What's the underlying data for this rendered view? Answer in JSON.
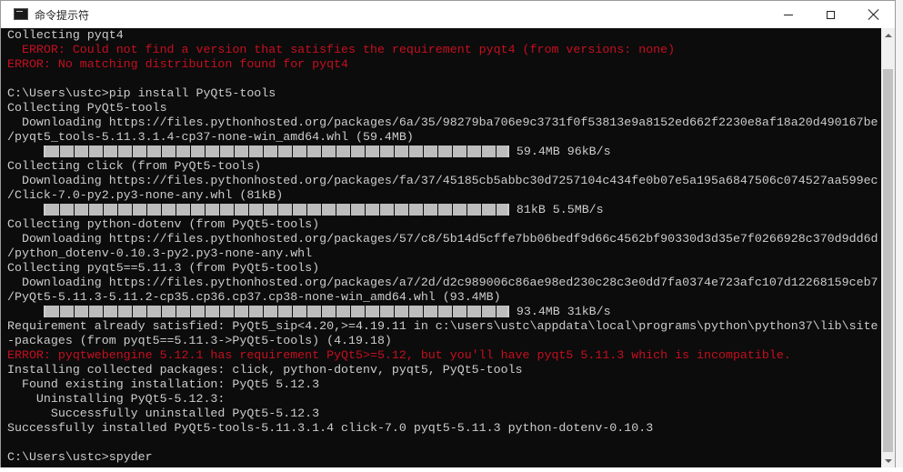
{
  "window": {
    "title": "命令提示符",
    "icon": "console-icon",
    "controls": {
      "minimize": "minimize-icon",
      "maximize": "maximize-icon",
      "close": "close-icon"
    }
  },
  "colors": {
    "console_bg": "#0c0c0c",
    "console_text": "#cccccc",
    "error_text": "#c50f1f"
  },
  "console": {
    "lines": [
      {
        "text": "Collecting pyqt4",
        "type": "normal"
      },
      {
        "text": "  ERROR: Could not find a version that satisfies the requirement pyqt4 (from versions: none)",
        "type": "error"
      },
      {
        "text": "ERROR: No matching distribution found for pyqt4",
        "type": "error"
      },
      {
        "text": "",
        "type": "normal"
      },
      {
        "text": "C:\\Users\\ustc>pip install PyQt5-tools",
        "type": "normal"
      },
      {
        "text": "Collecting PyQt5-tools",
        "type": "normal"
      },
      {
        "text": "  Downloading https://files.pythonhosted.org/packages/6a/35/98279ba706e9c3731f0f53813e9a8152ed662f2230e8af18a20d490167be",
        "type": "normal"
      },
      {
        "text": "/pyqt5_tools-5.11.3.1.4-cp37-none-win_amd64.whl (59.4MB)",
        "type": "normal"
      },
      {
        "type": "progress",
        "progress": 1.0,
        "text": " 59.4MB 96kB/s"
      },
      {
        "text": "Collecting click (from PyQt5-tools)",
        "type": "normal"
      },
      {
        "text": "  Downloading https://files.pythonhosted.org/packages/fa/37/45185cb5abbc30d7257104c434fe0b07e5a195a6847506c074527aa599ec",
        "type": "normal"
      },
      {
        "text": "/Click-7.0-py2.py3-none-any.whl (81kB)",
        "type": "normal"
      },
      {
        "type": "progress",
        "progress": 1.0,
        "text": " 81kB 5.5MB/s"
      },
      {
        "text": "Collecting python-dotenv (from PyQt5-tools)",
        "type": "normal"
      },
      {
        "text": "  Downloading https://files.pythonhosted.org/packages/57/c8/5b14d5cffe7bb06bedf9d66c4562bf90330d3d35e7f0266928c370d9dd6d",
        "type": "normal"
      },
      {
        "text": "/python_dotenv-0.10.3-py2.py3-none-any.whl",
        "type": "normal"
      },
      {
        "text": "Collecting pyqt5==5.11.3 (from PyQt5-tools)",
        "type": "normal"
      },
      {
        "text": "  Downloading https://files.pythonhosted.org/packages/a7/2d/d2c989006c86ae98ed230c28c3e0dd7fa0374e723afc107d12268159ceb7",
        "type": "normal"
      },
      {
        "text": "/PyQt5-5.11.3-5.11.2-cp35.cp36.cp37.cp38-none-win_amd64.whl (93.4MB)",
        "type": "normal"
      },
      {
        "type": "progress",
        "progress": 1.0,
        "text": " 93.4MB 31kB/s"
      },
      {
        "text": "Requirement already satisfied: PyQt5_sip<4.20,>=4.19.11 in c:\\users\\ustc\\appdata\\local\\programs\\python\\python37\\lib\\site",
        "type": "normal"
      },
      {
        "text": "-packages (from pyqt5==5.11.3->PyQt5-tools) (4.19.18)",
        "type": "normal"
      },
      {
        "text": "ERROR: pyqtwebengine 5.12.1 has requirement PyQt5>=5.12, but you'll have pyqt5 5.11.3 which is incompatible.",
        "type": "error"
      },
      {
        "text": "Installing collected packages: click, python-dotenv, pyqt5, PyQt5-tools",
        "type": "normal"
      },
      {
        "text": "  Found existing installation: PyQt5 5.12.3",
        "type": "normal"
      },
      {
        "text": "    Uninstalling PyQt5-5.12.3:",
        "type": "normal"
      },
      {
        "text": "      Successfully uninstalled PyQt5-5.12.3",
        "type": "normal"
      },
      {
        "text": "Successfully installed PyQt5-tools-5.11.3.1.4 click-7.0 pyqt5-5.11.3 python-dotenv-0.10.3",
        "type": "normal"
      },
      {
        "text": "",
        "type": "normal"
      },
      {
        "text": "C:\\Users\\ustc>spyder",
        "type": "normal"
      }
    ]
  },
  "scrollbar": {
    "up": "scroll-up-arrow-icon",
    "down": "scroll-down-arrow-icon"
  }
}
